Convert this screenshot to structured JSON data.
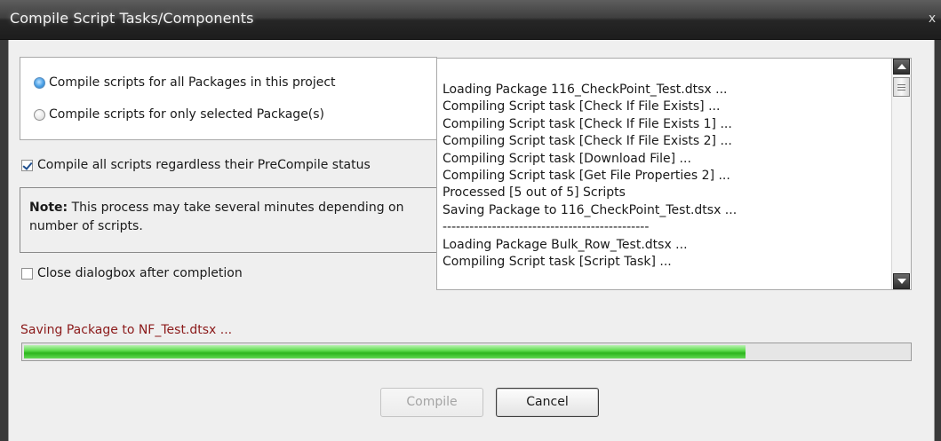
{
  "window": {
    "title": "Compile Script Tasks/Components",
    "close_glyph": "x"
  },
  "options": {
    "radio_all": {
      "label": "Compile scripts for all Packages in this project",
      "selected": true
    },
    "radio_selected": {
      "label": "Compile scripts for only selected Package(s)",
      "selected": false
    },
    "compile_all_checkbox": {
      "label": "Compile all scripts regardless their PreCompile status",
      "checked": true
    },
    "close_after_checkbox": {
      "label": "Close dialogbox after completion",
      "checked": false
    }
  },
  "note": {
    "bold": "Note:",
    "text": " This process may take several minutes depending on number of scripts."
  },
  "log": {
    "lines": [
      "Loading Package 116_CheckPoint_Test.dtsx ...",
      "Compiling Script task [Check If File Exists] ...",
      "Compiling Script task [Check If File Exists 1] ...",
      "Compiling Script task [Check If File Exists 2] ...",
      "Compiling Script task [Download File] ...",
      "Compiling Script task [Get File Properties 2] ...",
      "Processed [5 out of 5] Scripts",
      "Saving Package to 116_CheckPoint_Test.dtsx ...",
      "----------------------------------------------",
      "Loading Package Bulk_Row_Test.dtsx ...",
      "Compiling Script task [Script Task] ..."
    ]
  },
  "status": {
    "text": "Saving Package to NF_Test.dtsx ...",
    "color": "#8b1a1a",
    "progress_percent": 81.5
  },
  "buttons": {
    "compile_label": "Compile",
    "compile_enabled": false,
    "cancel_label": "Cancel"
  },
  "colors": {
    "progress_green": "#2cb51d",
    "radio_selected_blue": "#4aa0e6"
  }
}
